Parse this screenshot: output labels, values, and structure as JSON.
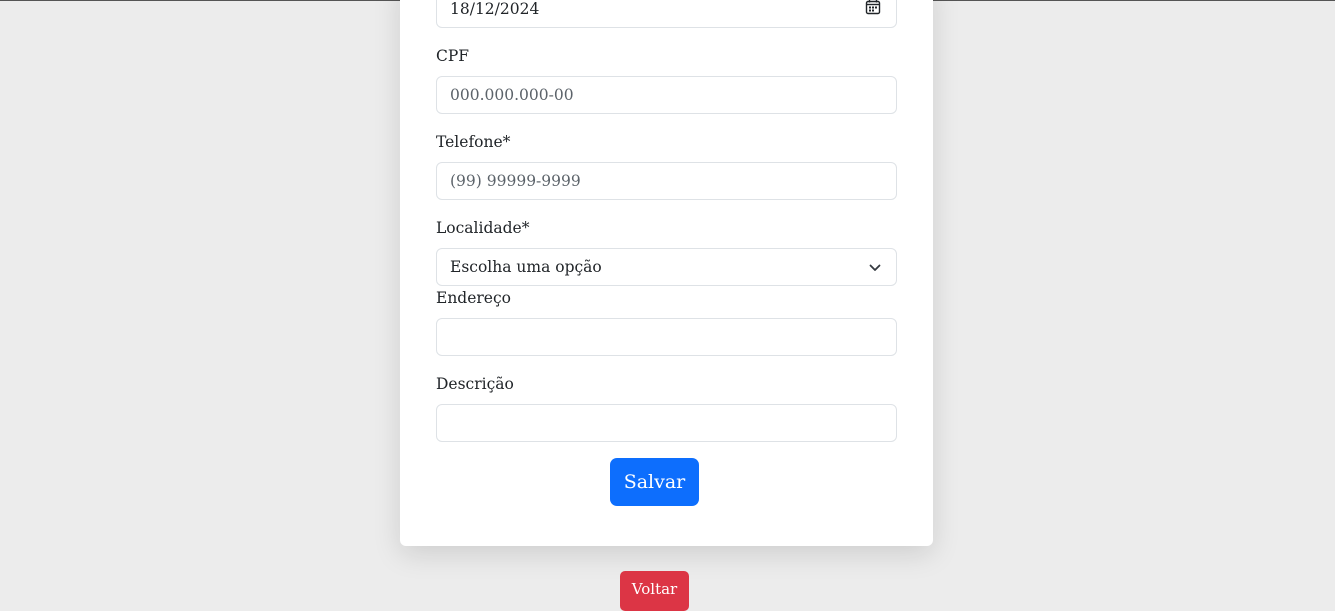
{
  "form": {
    "date": {
      "value": "18/12/2024",
      "icon": "calendar-icon"
    },
    "cpf": {
      "label": "CPF",
      "placeholder": "000.000.000-00"
    },
    "telefone": {
      "label": "Telefone*",
      "placeholder": "(99) 99999-9999"
    },
    "localidade": {
      "label": "Localidade*",
      "selected": "Escolha uma opção",
      "icon": "chevron-down-icon"
    },
    "endereco": {
      "label": "Endereço",
      "value": ""
    },
    "descricao": {
      "label": "Descrição",
      "value": ""
    },
    "save_label": "Salvar"
  },
  "back_label": "Voltar",
  "colors": {
    "background": "#ececec",
    "card": "#ffffff",
    "primary": "#0d6efd",
    "danger": "#dc3545",
    "border": "#dee2e6"
  }
}
